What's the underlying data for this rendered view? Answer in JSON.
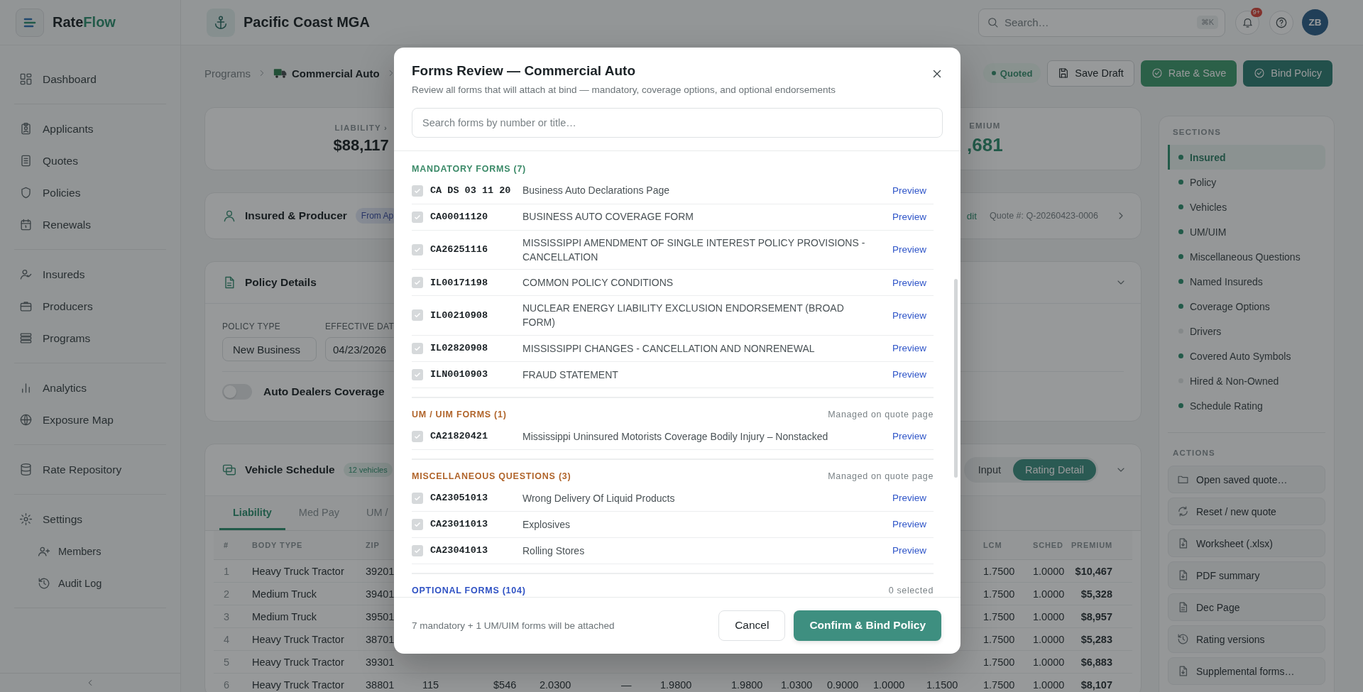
{
  "sidebar": {
    "logo": [
      "Rate",
      "Flow"
    ],
    "groups": [
      [
        {
          "label": "Dashboard"
        }
      ],
      [
        {
          "label": "Applicants"
        },
        {
          "label": "Quotes"
        },
        {
          "label": "Policies"
        },
        {
          "label": "Renewals"
        }
      ],
      [
        {
          "label": "Insureds"
        },
        {
          "label": "Producers"
        },
        {
          "label": "Programs"
        }
      ],
      [
        {
          "label": "Analytics"
        },
        {
          "label": "Exposure Map"
        }
      ],
      [
        {
          "label": "Rate Repository"
        }
      ],
      [
        {
          "label": "Settings",
          "children": [
            {
              "label": "Members"
            },
            {
              "label": "Audit Log"
            }
          ]
        }
      ]
    ]
  },
  "topbar": {
    "org": "Pacific Coast MGA",
    "search": {
      "placeholder": "Search…",
      "shortcut": "⌘K"
    },
    "notifications": "9+",
    "avatar": "ZB"
  },
  "breadcrumb": [
    "Programs",
    "Commercial Auto"
  ],
  "status": "Quoted",
  "actions": [
    {
      "label": "Save Draft",
      "kind": "secondary"
    },
    {
      "label": "Rate & Save",
      "kind": "success"
    },
    {
      "label": "Bind Policy",
      "kind": "primary"
    }
  ],
  "summary": [
    {
      "label": "LIABILITY ›",
      "value": "$88,117",
      "kind": "plain"
    },
    {
      "label": "EMIUM",
      "value": ",681",
      "kind": "total"
    }
  ],
  "insured_card": {
    "title": "Insured & Producer",
    "badge": "From Ap",
    "link": "dit",
    "quote": "Quote #: Q-20260423-0006"
  },
  "policy_card": {
    "title": "Policy Details",
    "fields": [
      {
        "label": "POLICY TYPE",
        "value": "New Business",
        "kind": "select"
      },
      {
        "label": "EFFECTIVE DAT",
        "value": "04/23/2026",
        "kind": "date"
      }
    ],
    "toggle": {
      "label": "Auto Dealers Coverage",
      "on": false
    }
  },
  "vehicle_card": {
    "title": "Vehicle Schedule",
    "count": "12 vehicles",
    "views": [
      {
        "label": "Input",
        "selected": false
      },
      {
        "label": "Rating Detail",
        "selected": true
      }
    ],
    "tabs": [
      {
        "label": "Liability",
        "selected": true
      },
      {
        "label": "Med Pay",
        "selected": false
      },
      {
        "label": "UM /",
        "selected": false
      }
    ],
    "table": {
      "columns": [
        "#",
        "BODY TYPE",
        "ZIP",
        null,
        null,
        null,
        null,
        null,
        null,
        null,
        null,
        null,
        null,
        "LCM",
        "SCHED",
        "PREMIUM"
      ],
      "rows": [
        [
          "1",
          "Heavy Truck Tractor",
          "39201",
          null,
          null,
          null,
          null,
          null,
          null,
          null,
          null,
          null,
          null,
          "1.7500",
          "1.0000",
          "$10,467"
        ],
        [
          "2",
          "Medium Truck",
          "39401",
          null,
          null,
          null,
          null,
          null,
          null,
          null,
          null,
          null,
          null,
          "1.7500",
          "1.0000",
          "$5,328"
        ],
        [
          "3",
          "Medium Truck",
          "39501",
          null,
          null,
          null,
          null,
          null,
          null,
          null,
          null,
          null,
          null,
          "1.7500",
          "1.0000",
          "$8,957"
        ],
        [
          "4",
          "Heavy Truck Tractor",
          "38701",
          null,
          null,
          null,
          null,
          null,
          null,
          null,
          null,
          null,
          null,
          "1.7500",
          "1.0000",
          "$5,283"
        ],
        [
          "5",
          "Heavy Truck Tractor",
          "39301",
          null,
          null,
          null,
          null,
          null,
          null,
          null,
          null,
          null,
          null,
          "1.7500",
          "1.0000",
          "$6,883"
        ],
        [
          "6",
          "Heavy Truck Tractor",
          "38801",
          "115",
          "$546",
          "2.0300",
          "—",
          "1.9800",
          "1.9800",
          "1.0300",
          "0.9000",
          "1.0000",
          "1.1500",
          "1.7500",
          "1.0000",
          "$8,107"
        ]
      ]
    }
  },
  "sections": {
    "title": "SECTIONS",
    "items": [
      {
        "label": "Insured",
        "selected": true,
        "complete": true
      },
      {
        "label": "Policy",
        "selected": false,
        "complete": true
      },
      {
        "label": "Vehicles",
        "selected": false,
        "complete": true
      },
      {
        "label": "UM/UIM",
        "selected": false,
        "complete": true
      },
      {
        "label": "Miscellaneous Questions",
        "selected": false,
        "complete": true
      },
      {
        "label": "Named Insureds",
        "selected": false,
        "complete": true
      },
      {
        "label": "Coverage Options",
        "selected": false,
        "complete": true
      },
      {
        "label": "Drivers",
        "selected": false,
        "complete": false
      },
      {
        "label": "Covered Auto Symbols",
        "selected": false,
        "complete": true
      },
      {
        "label": "Hired & Non-Owned",
        "selected": false,
        "complete": false
      },
      {
        "label": "Schedule Rating",
        "selected": false,
        "complete": true
      }
    ]
  },
  "actions_panel": {
    "title": "ACTIONS",
    "items": [
      "Open saved quote…",
      "Reset / new quote",
      "Worksheet (.xlsx)",
      "PDF summary",
      "Dec Page",
      "Rating versions",
      "Supplemental forms…"
    ]
  },
  "modal": {
    "title": "Forms Review — Commercial Auto",
    "subtitle": "Review all forms that will attach at bind — mandatory, coverage options, and optional endorsements",
    "search": {
      "placeholder": "Search forms by number or title…"
    },
    "sections": [
      {
        "kind": "mandatory",
        "title": "MANDATORY FORMS (7)",
        "forms": [
          {
            "code": "CA DS 03 11 20",
            "title": "Business Auto Declarations Page",
            "checked": true,
            "disabled": true,
            "link": "Preview"
          },
          {
            "code": "CA00011120",
            "title": "BUSINESS AUTO COVERAGE FORM",
            "checked": true,
            "disabled": true,
            "link": "Preview"
          },
          {
            "code": "CA26251116",
            "title": "MISSISSIPPI AMENDMENT OF SINGLE INTEREST POLICY PROVISIONS - CANCELLATION",
            "checked": true,
            "disabled": true,
            "link": "Preview"
          },
          {
            "code": "IL00171198",
            "title": "COMMON POLICY CONDITIONS",
            "checked": true,
            "disabled": true,
            "link": "Preview"
          },
          {
            "code": "IL00210908",
            "title": "NUCLEAR ENERGY LIABILITY EXCLUSION ENDORSEMENT (BROAD FORM)",
            "checked": true,
            "disabled": true,
            "link": "Preview"
          },
          {
            "code": "IL02820908",
            "title": "MISSISSIPPI CHANGES - CANCELLATION AND NONRENEWAL",
            "checked": true,
            "disabled": true,
            "link": "Preview"
          },
          {
            "code": "ILN0010903",
            "title": "FRAUD STATEMENT",
            "checked": true,
            "disabled": true,
            "link": "Preview"
          }
        ]
      },
      {
        "kind": "um",
        "title": "UM / UIM FORMS (1)",
        "note": "Managed on quote page",
        "forms": [
          {
            "code": "CA21820421",
            "title": "Mississippi Uninsured Motorists Coverage Bodily Injury – Nonstacked",
            "checked": true,
            "disabled": true,
            "link": "Preview"
          }
        ]
      },
      {
        "kind": "misc",
        "title": "MISCELLANEOUS QUESTIONS (3)",
        "note": "Managed on quote page",
        "forms": [
          {
            "code": "CA23051013",
            "title": "Wrong Delivery Of Liquid Products",
            "checked": true,
            "disabled": true,
            "link": "Preview"
          },
          {
            "code": "CA23011013",
            "title": "Explosives",
            "checked": true,
            "disabled": true,
            "link": "Preview"
          },
          {
            "code": "CA23041013",
            "title": "Rolling Stores",
            "checked": true,
            "disabled": true,
            "link": "Preview"
          }
        ]
      },
      {
        "kind": "optional",
        "title": "OPTIONAL FORMS (104)",
        "note": "0 selected"
      }
    ],
    "footer": {
      "text": "7 mandatory + 1 UM/UIM forms will be attached",
      "cancel": "Cancel",
      "confirm": "Confirm & Bind Policy"
    }
  }
}
